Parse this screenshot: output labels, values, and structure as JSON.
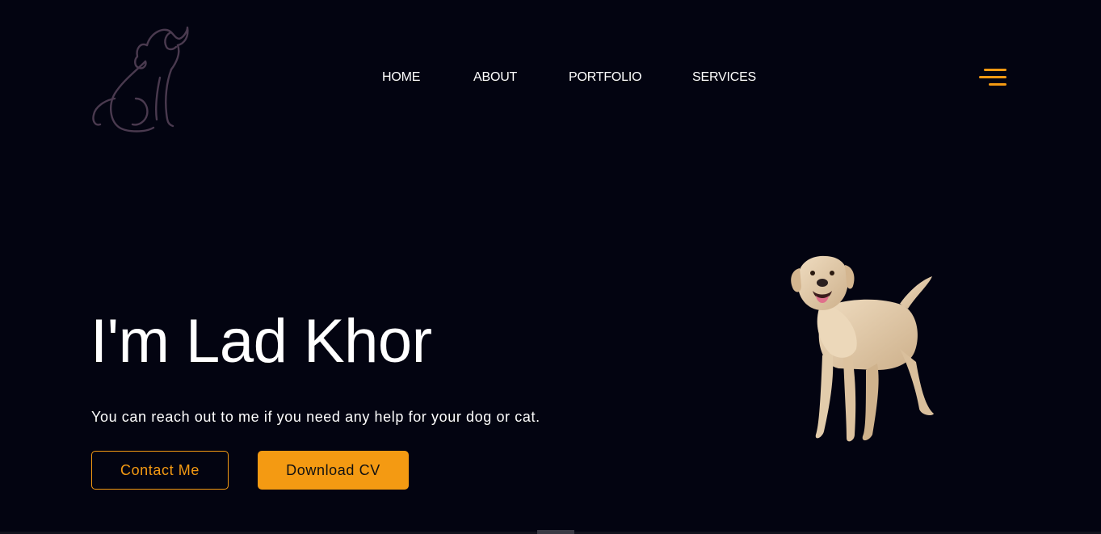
{
  "header": {
    "logo_icon": "dog-outline-icon",
    "logo_color": "#4a3a4f",
    "nav": [
      {
        "label": "HOME"
      },
      {
        "label": "ABOUT"
      },
      {
        "label": "PORTFOLIO"
      },
      {
        "label": "SERVICES"
      }
    ],
    "menu_icon": "hamburger-menu-icon",
    "accent_color": "#f49a12"
  },
  "hero": {
    "title": "I'm Lad Khor",
    "subtitle": "You can reach out to me if you need any help for your dog or cat.",
    "buttons": {
      "contact_label": "Contact Me",
      "download_label": "Download CV"
    },
    "image_icon": "labrador-dog-photo"
  },
  "colors": {
    "background": "#030411",
    "text": "#ffffff",
    "accent": "#f49a12"
  }
}
